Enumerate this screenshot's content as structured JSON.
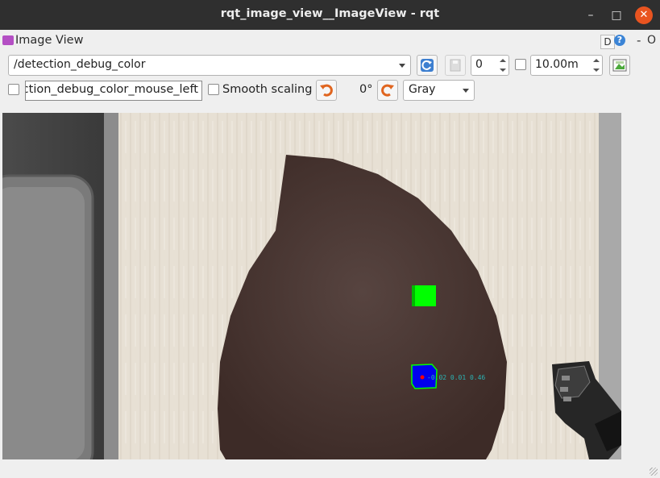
{
  "window": {
    "title": "rqt_image_view__ImageView - rqt"
  },
  "panel": {
    "title": "Image View",
    "d_label": "D",
    "help_label": "?",
    "minus_label": "-",
    "o_label": "O"
  },
  "toolbar": {
    "topic_combo_value": "/detection_debug_color",
    "spin_value": "0",
    "duration_value": "10.00m",
    "mouse_topic_value": "ection_debug_color_mouse_left",
    "smooth_scaling_label": "Smooth scaling",
    "rotation_label": "0°",
    "color_scheme_value": "Gray"
  },
  "image": {
    "marker_label": "-0.02 0.01 0.46",
    "colors": {
      "table": "#e6dfd3",
      "disk": "#4a3732",
      "green_marker": "#00ff00",
      "blue_marker": "#0000ee",
      "robot_dark": "#262626"
    }
  },
  "icons": {
    "refresh": "refresh-icon",
    "save": "save-icon",
    "rotate_left": "rotate-left-icon",
    "rotate_right": "rotate-right-icon",
    "fit": "fit-image-icon"
  }
}
